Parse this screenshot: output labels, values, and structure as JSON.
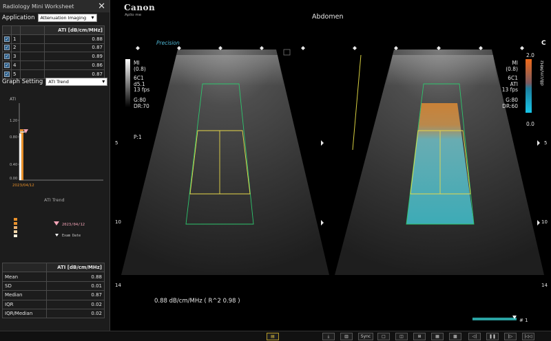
{
  "worksheet": {
    "title": "Radiology Mini Worksheet",
    "application_label": "Application",
    "application_value": "Attenuation Imaging",
    "table_header": "ATI [dB/cm/MHz]",
    "rows": [
      {
        "index": "1",
        "value": "0.88"
      },
      {
        "index": "2",
        "value": "0.87"
      },
      {
        "index": "3",
        "value": "0.89"
      },
      {
        "index": "4",
        "value": "0.86"
      },
      {
        "index": "5",
        "value": "0.87"
      }
    ],
    "graph_setting_label": "Graph Setting",
    "graph_setting_value": "ATI Trend"
  },
  "trend_chart": {
    "y_axis_title": "ATI",
    "y_ticks": [
      "1.20",
      "0.80",
      "0.40",
      "0.00"
    ],
    "date_label": "2023/04/12",
    "title": "ATI Trend",
    "legend_date": "2023/04/12",
    "legend_exam": "Exam Date",
    "colors": {
      "bar": "#e8902a",
      "marker": "#f6a5b8",
      "line": "#ffffff"
    }
  },
  "chart_data": {
    "type": "bar",
    "categories": [
      "2023/04/12"
    ],
    "values": [
      0.88
    ],
    "ylim": [
      0,
      1.4
    ],
    "title": "ATI Trend",
    "ylabel": "ATI"
  },
  "stats": {
    "header": "ATI [dB/cm/MHz]",
    "rows": [
      {
        "label": "Mean",
        "value": "0.88"
      },
      {
        "label": "SD",
        "value": "0.01"
      },
      {
        "label": "Median",
        "value": "0.87"
      },
      {
        "label": "IQR",
        "value": "0.02"
      },
      {
        "label": "IQR/Median",
        "value": "0.02"
      }
    ]
  },
  "viewer": {
    "brand": "Canon",
    "model": "Aplio me",
    "exam": "Abdomen",
    "mode_label": "Precision",
    "left_params": [
      "MI",
      "(0.8)",
      "",
      "6C1",
      "d5.1",
      "13 fps",
      "",
      "G:80",
      "DR:70"
    ],
    "left_p": "P:1",
    "right_params": [
      "MI",
      "(0.8)",
      "",
      "6C1",
      "ATI",
      "13 fps",
      "",
      "G:80",
      "DR:60"
    ],
    "color_scale_max": "2.0",
    "color_scale_min": "0.0",
    "color_scale_unit": "dB/cm/MHz",
    "depths": [
      "5",
      "10",
      "14"
    ],
    "measurement": "0.88 dB/cm/MHz   ( R^2 0.98 )",
    "cine_label": "# 1",
    "corner_label": "C",
    "sync_label": "Sync"
  }
}
